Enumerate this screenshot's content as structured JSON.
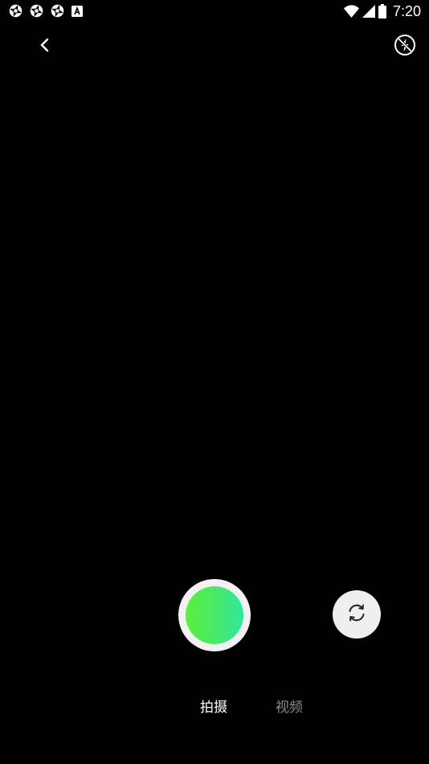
{
  "status_bar": {
    "time": "7:20",
    "notification_icons": [
      "aperture-icon",
      "aperture-icon",
      "aperture-icon",
      "text-a-icon"
    ],
    "system_icons": [
      "wifi-icon",
      "cellular-signal-icon",
      "battery-icon"
    ]
  },
  "toolbar": {
    "back_icon": "chevron-left-icon",
    "flash_icon": "flash-off-icon"
  },
  "controls": {
    "shutter_icon": "shutter-icon",
    "switch_camera_icon": "camera-switch-icon"
  },
  "modes": {
    "tabs": [
      {
        "label": "拍摄",
        "active": true
      },
      {
        "label": "视频",
        "active": false
      }
    ]
  },
  "colors": {
    "background": "#000000",
    "shutter_ring": "#f2f2f2",
    "shutter_gradient_start": "#5af03c",
    "shutter_gradient_end": "#2ee8a0",
    "inactive_tab": "#8a8a8a"
  }
}
